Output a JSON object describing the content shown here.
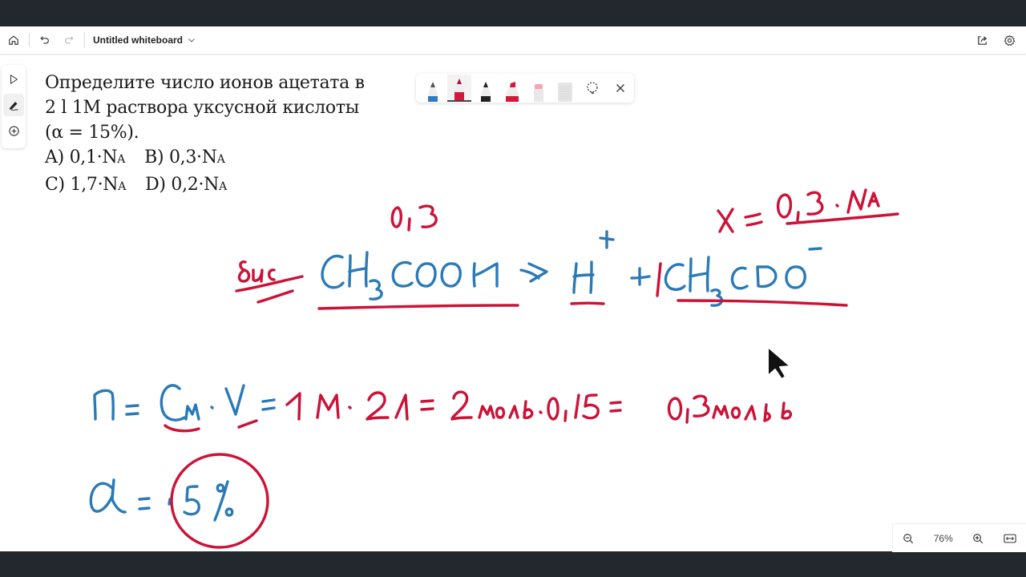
{
  "window": {
    "title": "Untitled whiteboard"
  },
  "titlebar": {
    "icons": [
      "home-icon",
      "undo-icon",
      "redo-icon",
      "share-icon",
      "settings-icon"
    ]
  },
  "sidebar": {
    "tools": [
      {
        "name": "select",
        "icon": "cursor-icon",
        "active": false
      },
      {
        "name": "pen",
        "icon": "pen-icon",
        "active": true
      },
      {
        "name": "add",
        "icon": "plus-circle-icon",
        "active": false
      }
    ]
  },
  "question": {
    "lines": [
      "Определите число ионов ацетата в",
      "2 l 1M раствора уксусной кислоты",
      "(α = 15%)."
    ],
    "options": [
      {
        "label": "A) 0,1·N",
        "sub": "A"
      },
      {
        "label": "B) 0,3·N",
        "sub": "A"
      },
      {
        "label": "C) 1,7·N",
        "sub": "A"
      },
      {
        "label": "D) 0,2·N",
        "sub": "A"
      }
    ]
  },
  "pen_tray": {
    "pens": [
      {
        "name": "blue-pen",
        "color": "#2f7bc4",
        "active": false
      },
      {
        "name": "red-pen",
        "color": "#d6163d",
        "active": true
      },
      {
        "name": "black-pen",
        "color": "#222222",
        "active": false
      },
      {
        "name": "red-highlighter",
        "color": "#d6163d",
        "active": false
      },
      {
        "name": "eraser",
        "color": "#f4a6b4",
        "active": false
      },
      {
        "name": "ruler",
        "color": "#dddddd",
        "active": false
      }
    ],
    "lasso_icon": "lasso-icon",
    "close_icon": "close-icon"
  },
  "ink": {
    "blue": "#2a7ab8",
    "red": "#cc1237",
    "annotations": {
      "top_value": "0,3",
      "label_left": "дис",
      "equation": "CH3COOH → H+ + CH3COO−",
      "x_result": "x = 0,3·NA",
      "formula": "n = Cm·V = 1M·2л = 2 моль·0,15 = 0,3 моль",
      "alpha": "α = 15%"
    }
  },
  "zoom": {
    "level": "76%"
  }
}
